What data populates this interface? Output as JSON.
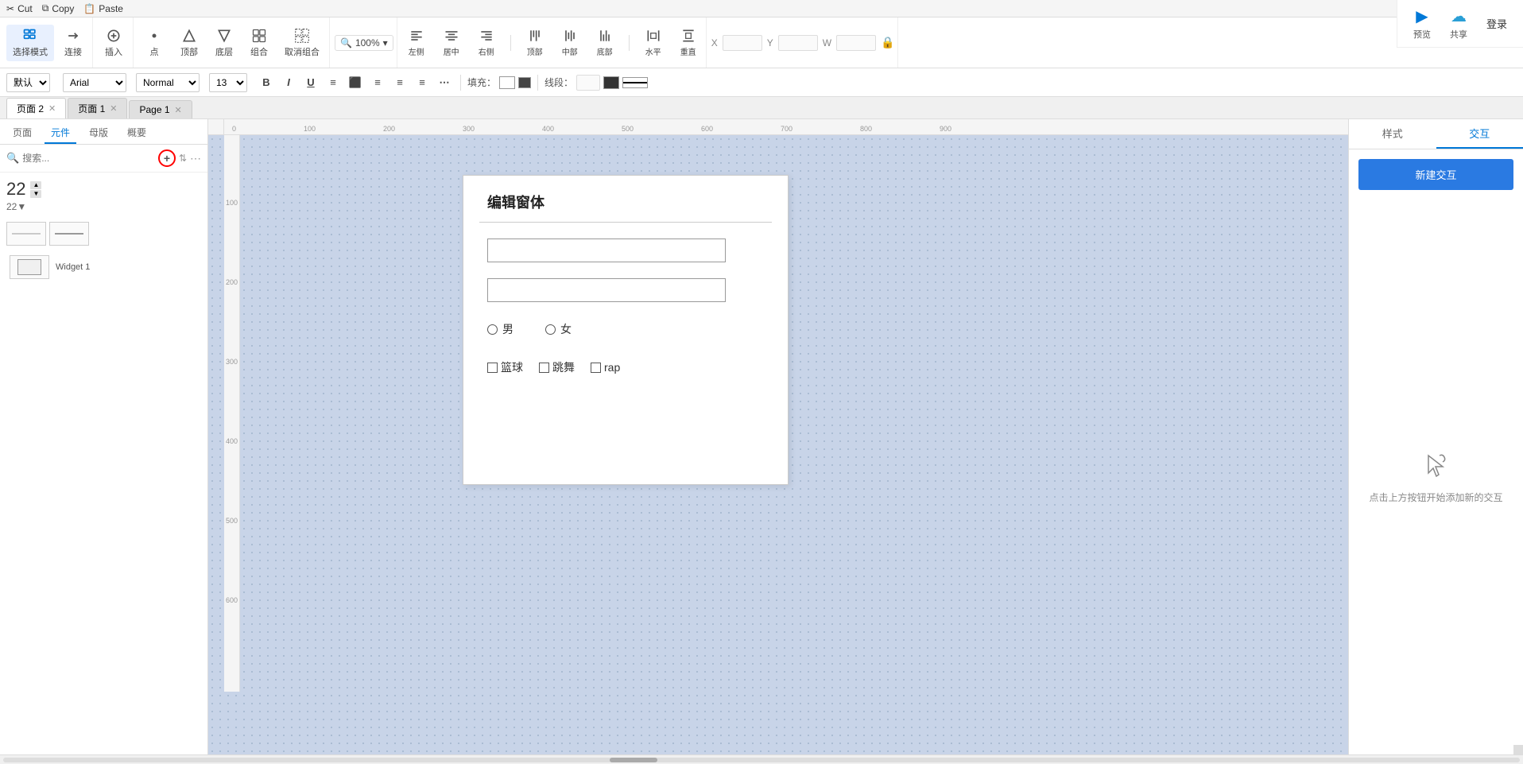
{
  "menus": {
    "cut": "Cut",
    "copy": "Copy",
    "paste": "Paste"
  },
  "toolbar": {
    "select_mode": "选择模式",
    "connect": "连接",
    "insert": "插入",
    "dot": "点",
    "top": "顶部",
    "bottom": "底层",
    "group": "组合",
    "ungroup": "取消组合",
    "zoom": "100%",
    "left": "左侧",
    "center": "居中",
    "right": "右侧",
    "top_align": "顶部",
    "middle": "中部",
    "bottom_align": "底部",
    "horizontal": "水平",
    "vertical": "重直",
    "x_label": "X",
    "y_label": "Y",
    "w_label": "W"
  },
  "font_toolbar": {
    "default_style": "默认",
    "font_family": "Arial",
    "font_style": "Normal",
    "font_size": "13",
    "bold": "B",
    "italic": "I",
    "underline": "U",
    "list": "≡",
    "fill_label": "填充：",
    "stroke_label": "线段："
  },
  "tabs": {
    "page2": "页面 2",
    "page1": "页面 1",
    "page_en": "Page 1"
  },
  "left_sidebar": {
    "tab_pages": "页面",
    "tab_components": "元件",
    "tab_masters": "母版",
    "tab_summary": "概要",
    "search_placeholder": "搜索...",
    "widget_count": "22",
    "widget_sub": "22▼",
    "widget1_name": "Widget 1"
  },
  "canvas": {
    "frame_title": "编辑窗体",
    "input1_placeholder": "",
    "input2_placeholder": "",
    "radio1": "男",
    "radio2": "女",
    "checkbox1": "篮球",
    "checkbox2": "跳舞",
    "checkbox3": "rap"
  },
  "right_panel": {
    "tab_style": "样式",
    "tab_interaction": "交互",
    "new_btn": "新建交互",
    "empty_hint": "点击上方按钮开始添加新的交互"
  },
  "top_right": {
    "preview_label": "预览",
    "share_label": "共享",
    "login_label": "登录"
  },
  "ruler": {
    "marks_h": [
      "0",
      "100",
      "200",
      "300",
      "400",
      "500",
      "600",
      "700",
      "800",
      "900"
    ],
    "marks_v": [
      "100",
      "200",
      "300",
      "400",
      "500",
      "600"
    ]
  }
}
